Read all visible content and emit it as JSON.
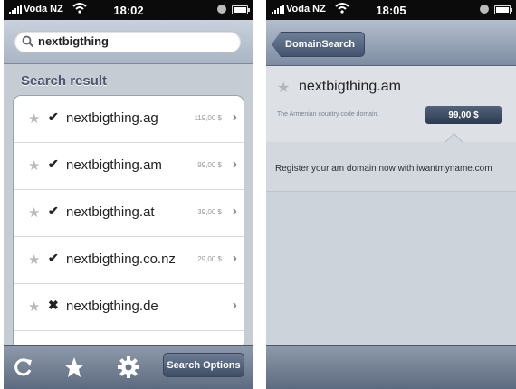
{
  "left": {
    "status": {
      "carrier": "Voda NZ",
      "time": "18:02"
    },
    "search": {
      "value": "nextbigthing"
    },
    "section_title": "Search result",
    "results": [
      {
        "domain": "nextbigthing.ag",
        "price": "119,00 $",
        "status": "available"
      },
      {
        "domain": "nextbigthing.am",
        "price": "99,00 $",
        "status": "available"
      },
      {
        "domain": "nextbigthing.at",
        "price": "39,00 $",
        "status": "available"
      },
      {
        "domain": "nextbigthing.co.nz",
        "price": "29,00 $",
        "status": "available"
      },
      {
        "domain": "nextbigthing.de",
        "price": "",
        "status": "taken"
      }
    ],
    "toolbar": {
      "options_label": "Search Options"
    }
  },
  "right": {
    "status": {
      "carrier": "Voda NZ",
      "time": "18:05"
    },
    "back_label": "DomainSearch",
    "detail": {
      "domain": "nextbigthing.am",
      "description": "The Armenian country code domain.",
      "price": "99,00 $"
    },
    "promo": "Register your am domain now with iwantmyname.com"
  },
  "colors": {
    "toolbar": "#6b788b",
    "price_button": "#3d4c63",
    "list_bg": "#c5ccd4"
  }
}
